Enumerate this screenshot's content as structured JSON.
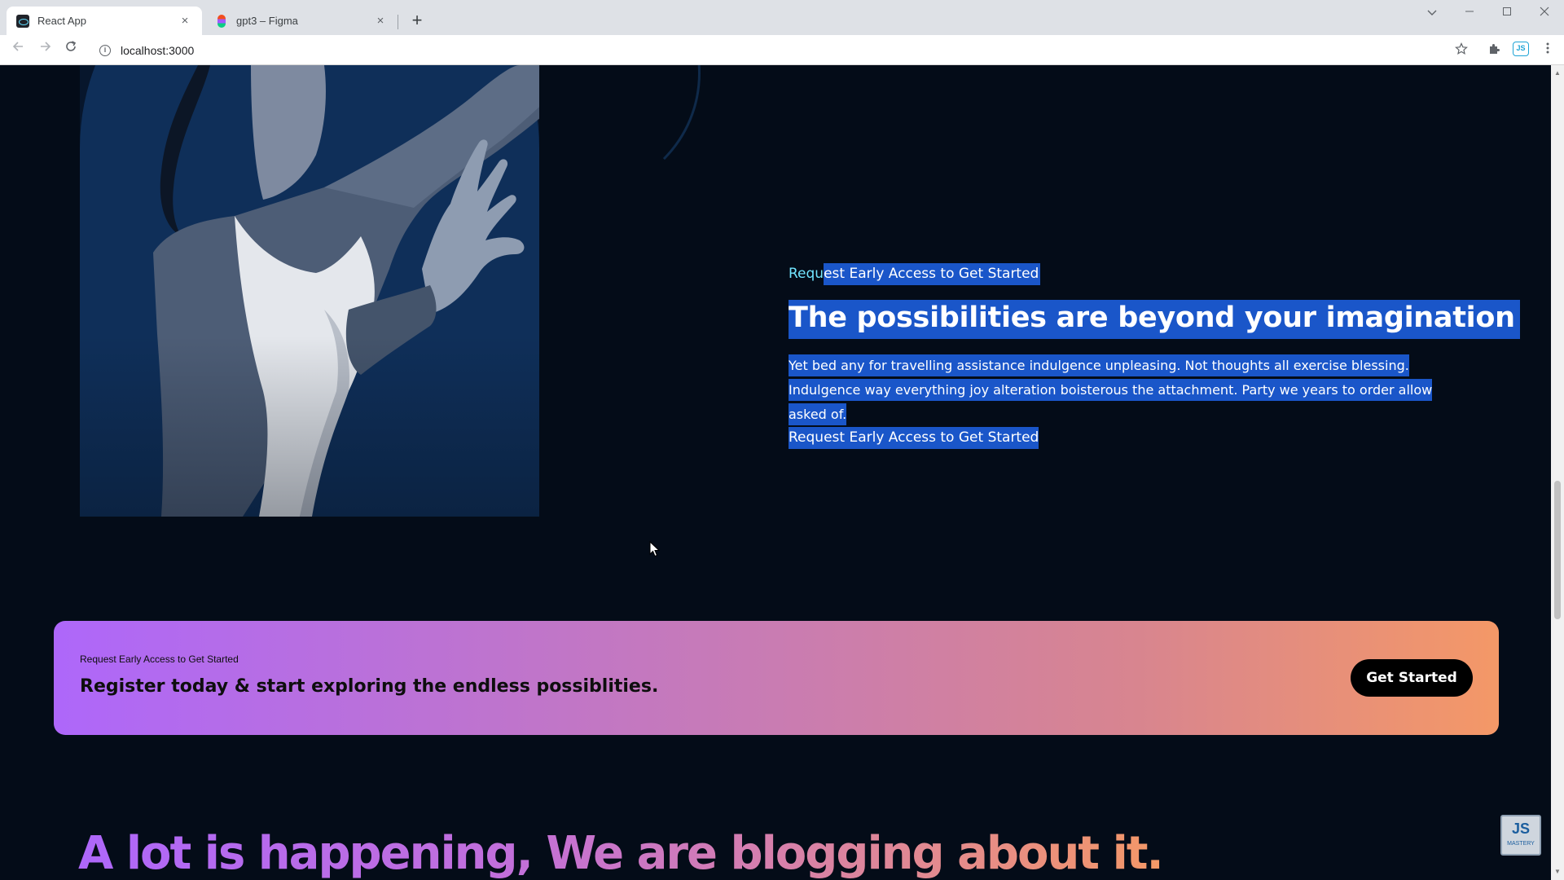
{
  "browser": {
    "tabs": [
      {
        "title": "React App",
        "active": true,
        "icon": "react-icon"
      },
      {
        "title": "gpt3 – Figma",
        "active": false,
        "icon": "figma-icon"
      }
    ],
    "new_tab_glyph": "+",
    "close_glyph": "×",
    "url": "localhost:3000",
    "extension_label": "JS"
  },
  "content": {
    "image_section": {
      "eyebrow_unselected": "Requ",
      "eyebrow_selected": "est Early Access to Get Started",
      "headline": "The possibilities are beyond your imagination",
      "paragraph": "Yet bed any for travelling assistance indulgence unpleasing. Not thoughts all exercise blessing. Indulgence way everything joy alteration boisterous the attachment. Party we years to order allow asked of.",
      "cta_link": "Request Early Access to Get Started",
      "selection_color": "#1a56c9",
      "eyebrow_color": "#71e5ff"
    },
    "banner": {
      "eyebrow": "Request Early Access to Get Started",
      "title": "Register today & start exploring the endless possiblities.",
      "button": "Get Started",
      "gradient_start": "#ae67fa",
      "gradient_end": "#f49867"
    },
    "blog_heading": "A lot is happening, We are blogging about it.",
    "watermark": {
      "logo": "JS",
      "caption": "MASTERY"
    }
  },
  "colors": {
    "page_background": "#040c18",
    "accent_purple": "#ae67fa",
    "accent_orange": "#f49867"
  }
}
